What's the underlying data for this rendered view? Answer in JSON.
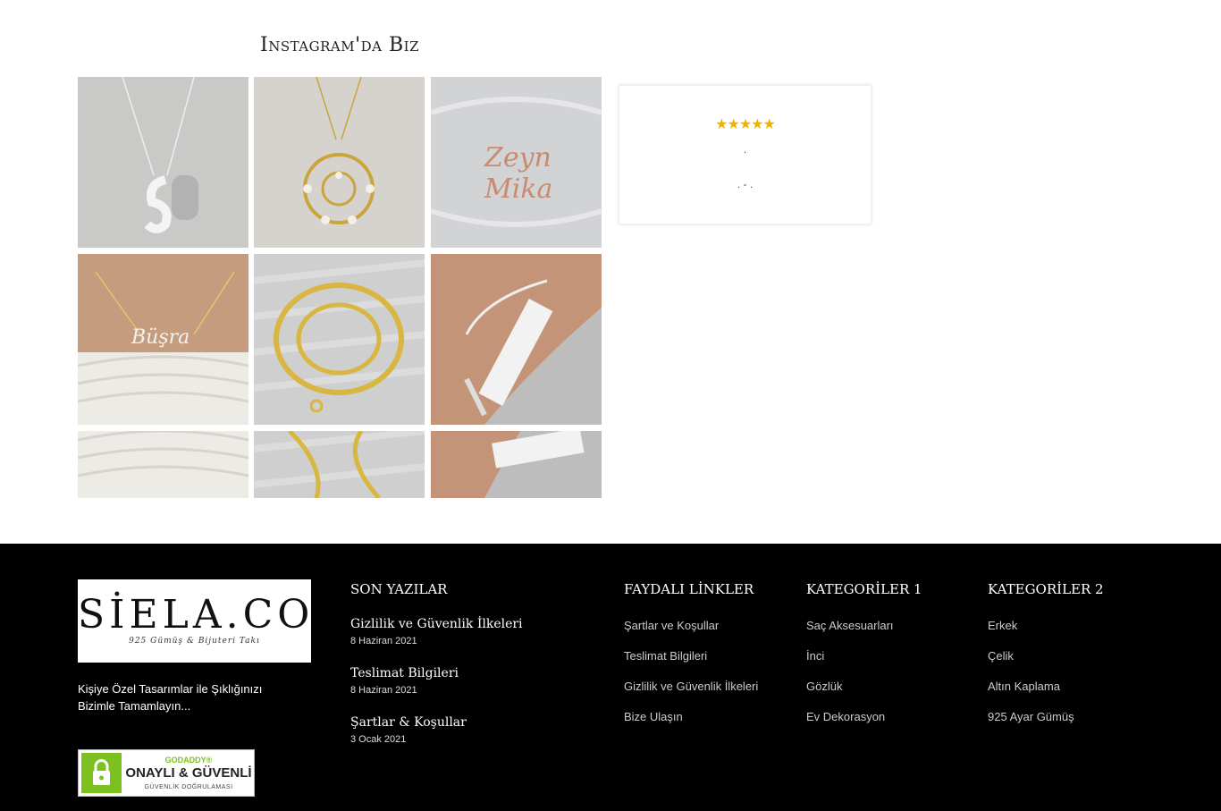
{
  "instagram": {
    "title": "Instagram'da Biz"
  },
  "review": {
    "stars": "★★★★★",
    "line1": ".",
    "line2": ". - ."
  },
  "footer": {
    "logo": {
      "name": "SİELA.CO",
      "sub": "925 Gümüş & Bijuteri Takı"
    },
    "tagline": "Kişiye Özel Tasarımlar ile Şıklığınızı Bizimle Tamamlayın...",
    "badge": {
      "brand": "GODADDY®",
      "main": "ONAYLI & GÜVENLİ",
      "sub": "GÜVENLİK DOĞRULAMASI"
    },
    "recent_posts": {
      "title": "SON YAZILAR",
      "items": [
        {
          "title": "Gizlilik ve Güvenlik İlkeleri",
          "date": "8 Haziran 2021"
        },
        {
          "title": "Teslimat Bilgileri",
          "date": "8 Haziran 2021"
        },
        {
          "title": "Şartlar & Koşullar",
          "date": "3 Ocak 2021"
        }
      ]
    },
    "useful_links": {
      "title": "FAYDALI LİNKLER",
      "items": [
        "Şartlar ve Koşullar",
        "Teslimat Bilgileri",
        "Gizlilik ve Güvenlik İlkeleri",
        "Bize Ulaşın"
      ]
    },
    "categories1": {
      "title": "KATEGORİLER 1",
      "items": [
        "Saç Aksesuarları",
        "İnci",
        "Gözlük",
        "Ev Dekorasyon"
      ]
    },
    "categories2": {
      "title": "KATEGORİLER 2",
      "items": [
        "Erkek",
        "Çelik",
        "Altın Kaplama",
        "925 Ayar Gümüş"
      ]
    }
  },
  "colors": {
    "footer_bg": "#000000",
    "star": "#f0b400",
    "badge_green": "#7cc11f"
  }
}
